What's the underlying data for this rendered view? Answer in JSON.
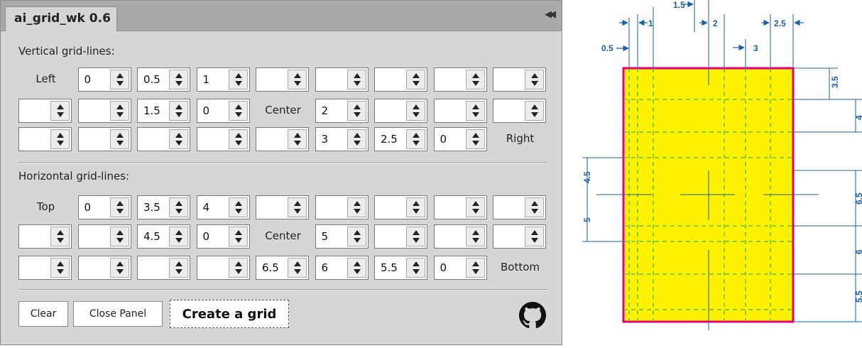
{
  "panel": {
    "title": "ai_grid_wk 0.6",
    "collapse_icon": "double-chevron-left-icon",
    "vertical_label": "Vertical grid-lines:",
    "horizontal_label": "Horizontal grid-lines:",
    "vertical_rows": [
      [
        "Left",
        "0",
        "0.5",
        "1",
        "",
        "",
        "",
        "",
        ""
      ],
      [
        "",
        "",
        "1.5",
        "0",
        "Center",
        "2",
        "",
        "",
        ""
      ],
      [
        "",
        "",
        "",
        "",
        "",
        "3",
        "2.5",
        "0",
        "Right"
      ]
    ],
    "horizontal_rows": [
      [
        "Top",
        "0",
        "3.5",
        "4",
        "",
        "",
        "",
        "",
        ""
      ],
      [
        "",
        "",
        "4.5",
        "0",
        "Center",
        "5",
        "",
        "",
        ""
      ],
      [
        "",
        "",
        "",
        "",
        "6.5",
        "6",
        "5.5",
        "0",
        "Bottom"
      ]
    ],
    "label_cells": [
      "Left",
      "Center",
      "Right",
      "Top",
      "Bottom"
    ],
    "clear_button": "Clear",
    "close_button": "Close Panel",
    "create_button": "Create a grid",
    "github_icon": "github-icon"
  },
  "diagram": {
    "colors": {
      "artboard_fill": "#fff200",
      "artboard_border": "#e6007e",
      "guides": "#3cb44b",
      "dimensions": "#1a5fa8"
    },
    "top_labels": [
      "1.5",
      "1",
      "2",
      "2.5",
      "0.5",
      "3"
    ],
    "right_labels": [
      "3.5",
      "4",
      "6.5",
      "6",
      "5.5"
    ],
    "left_labels": [
      "4.5",
      "5"
    ]
  }
}
